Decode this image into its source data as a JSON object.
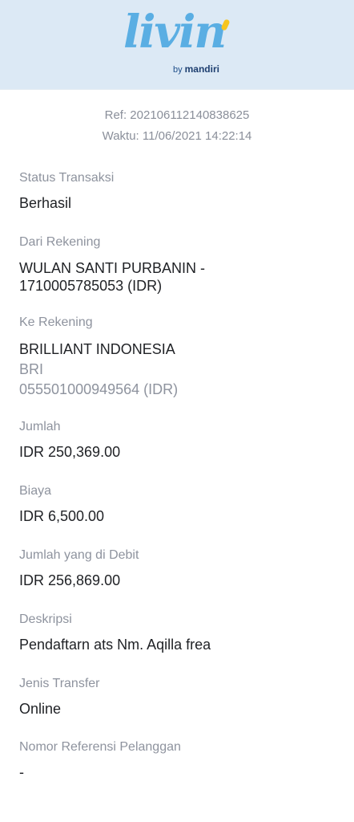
{
  "header": {
    "logo_word": "livin",
    "logo_by": "by",
    "logo_brand": "mandiri"
  },
  "receipt": {
    "ref": "Ref: 202106112140838625",
    "time": "Waktu: 11/06/2021 14:22:14"
  },
  "fields": {
    "status": {
      "label": "Status Transaksi",
      "value": "Berhasil"
    },
    "from": {
      "label": "Dari Rekening",
      "value_line1": "WULAN SANTI PURBANIN -",
      "value_line2": "1710005785053 (IDR)"
    },
    "to": {
      "label": "Ke Rekening",
      "name": "BRILLIANT INDONESIA",
      "bank": "BRI",
      "account": "055501000949564 (IDR)"
    },
    "amount": {
      "label": "Jumlah",
      "value": "IDR 250,369.00"
    },
    "fee": {
      "label": "Biaya",
      "value": "IDR 6,500.00"
    },
    "debited": {
      "label": "Jumlah yang di Debit",
      "value": "IDR 256,869.00"
    },
    "description": {
      "label": "Deskripsi",
      "value": "Pendaftarn ats Nm. Aqilla frea"
    },
    "transfer_type": {
      "label": "Jenis Transfer",
      "value": "Online"
    },
    "customer_ref": {
      "label": "Nomor Referensi Pelanggan",
      "value": "-"
    }
  }
}
